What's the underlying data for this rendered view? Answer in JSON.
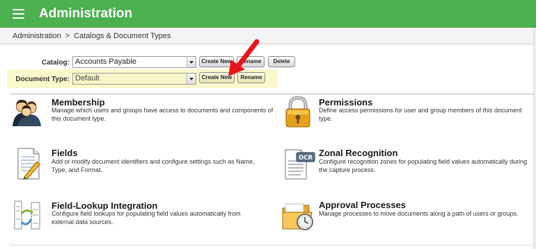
{
  "header": {
    "title": "Administration"
  },
  "breadcrumb": {
    "root": "Administration",
    "separator": ">",
    "current": "Catalogs & Document Types"
  },
  "catalog": {
    "label": "Catalog:",
    "selected": "Accounts Payable",
    "create_new_label": "Create New",
    "rename_label": "Rename",
    "delete_label": "Delete"
  },
  "document_type": {
    "label": "Document Type:",
    "selected": "Default",
    "create_new_label": "Create New",
    "rename_label": "Rename"
  },
  "features": [
    {
      "title": "Membership",
      "description": "Manage which users and groups have access to documents and components of this document type.",
      "icon": "users-icon"
    },
    {
      "title": "Permissions",
      "description": "Define access permissions for user and group members of this document type.",
      "icon": "lock-icon"
    },
    {
      "title": "Fields",
      "description": "Add or modify document identifiers and configure settings such as Name, Type, and Format.",
      "icon": "document-pencil-icon"
    },
    {
      "title": "Zonal Recognition",
      "description": "Configure recognition zones for populating field values automatically during the capture process.",
      "icon": "ocr-document-icon"
    },
    {
      "title": "Field-Lookup Integration",
      "description": "Configure field lookups for populating field values automatically from external data sources.",
      "icon": "field-lookup-icon"
    },
    {
      "title": "Approval Processes",
      "description": "Manage processes to move documents along a path of users or groups.",
      "icon": "folder-clock-icon"
    }
  ],
  "colors": {
    "header_bg": "#4caf50",
    "highlight_bg": "#fbf8cc",
    "annotation_arrow": "#e8141b"
  }
}
